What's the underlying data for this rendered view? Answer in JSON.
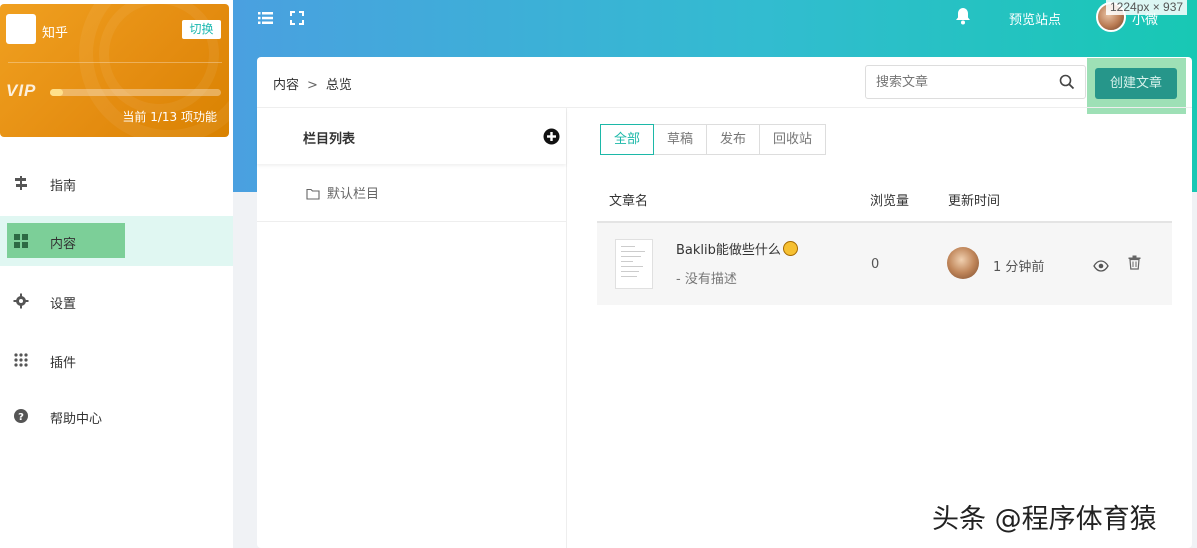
{
  "window": {
    "dimension_label": "1224px × 937"
  },
  "sidebar": {
    "site_name": "知乎",
    "switch_label": "切换",
    "vip_label": "VIP",
    "vip_progress_fraction": 0.077,
    "vip_count_text": "当前 1/13 项功能",
    "items": [
      {
        "label": "指南",
        "icon": "guide-icon"
      },
      {
        "label": "内容",
        "icon": "grid-icon",
        "active": true
      },
      {
        "label": "设置",
        "icon": "gear-icon"
      },
      {
        "label": "插件",
        "icon": "dots-grid-icon"
      },
      {
        "label": "帮助中心",
        "icon": "question-circle-icon"
      }
    ]
  },
  "header": {
    "preview_label": "预览站点",
    "username": "小微"
  },
  "breadcrumb": {
    "first": "内容",
    "separator": ">",
    "second": "总览"
  },
  "search": {
    "placeholder": "搜索文章"
  },
  "create_label": "创建文章",
  "columns": {
    "title": "栏目列表",
    "default_label": "默认栏目"
  },
  "tabs": [
    {
      "label": "全部",
      "active": true
    },
    {
      "label": "草稿"
    },
    {
      "label": "发布"
    },
    {
      "label": "回收站"
    }
  ],
  "table": {
    "headers": {
      "name": "文章名",
      "views": "浏览量",
      "updated": "更新时间"
    },
    "rows": [
      {
        "title": "Baklib能做些什么",
        "desc": "- 没有描述",
        "views": "0",
        "updated": "1 分钟前"
      }
    ]
  },
  "watermark": "头条 @程序体育猿",
  "colors": {
    "accent": "#1cb8a8",
    "vip_orange": "#e8900f",
    "create_button": "#26968a"
  }
}
